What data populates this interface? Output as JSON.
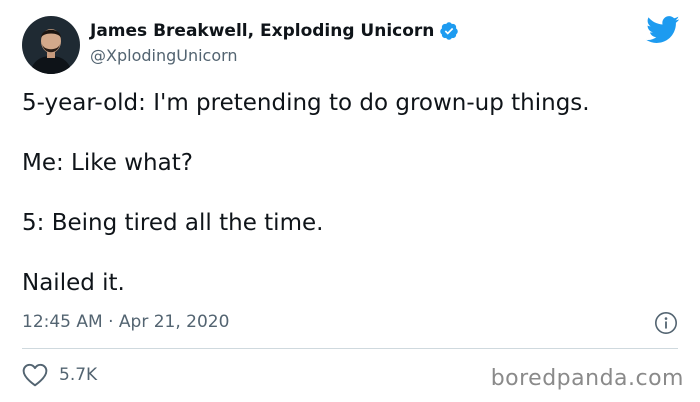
{
  "author": {
    "name": "James Breakwell, Exploding Unicorn",
    "handle": "@XplodingUnicorn",
    "verified": true
  },
  "tweet": {
    "lines": [
      "5-year-old: I'm pretending to do grown-up things.",
      "Me: Like what?",
      "5: Being tired all the time.",
      "Nailed it."
    ],
    "timestamp": "12:45 AM · Apr 21, 2020"
  },
  "engagement": {
    "likes": "5.7K"
  },
  "watermark": "boredpanda.com",
  "colors": {
    "twitter_blue": "#1d9bf0",
    "secondary_text": "#536471",
    "divider": "#cfd9de"
  },
  "icons": {
    "brand": "twitter-bird-icon",
    "verified": "verified-badge-icon",
    "info": "info-icon",
    "like": "heart-icon"
  }
}
